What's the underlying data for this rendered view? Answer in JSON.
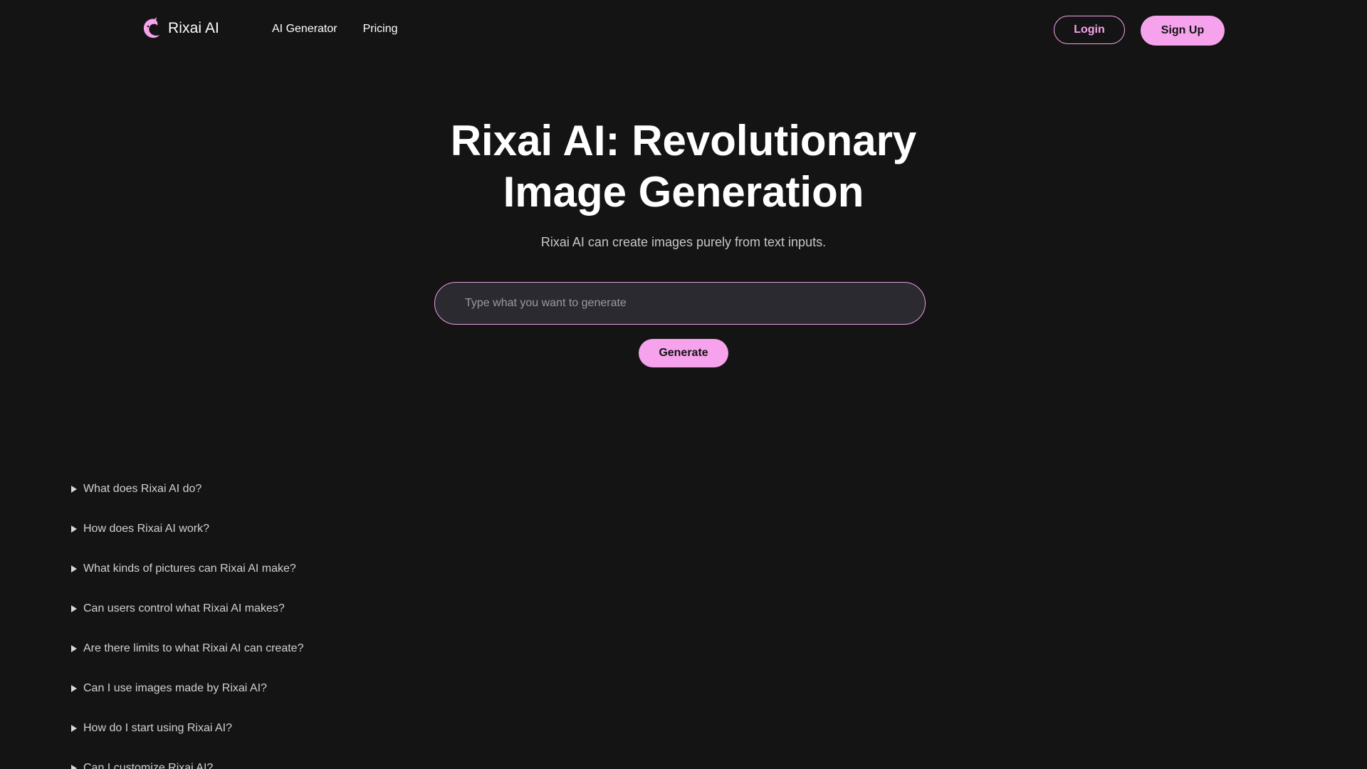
{
  "header": {
    "brand": "Rixai AI",
    "logo_icon": "dolphin-logo-icon",
    "nav": [
      {
        "label": "AI Generator"
      },
      {
        "label": "Pricing"
      }
    ],
    "login_label": "Login",
    "signup_label": "Sign Up"
  },
  "hero": {
    "title_line1": "Rixai AI: Revolutionary",
    "title_line2": "Image Generation",
    "subtitle": "Rixai AI can create images purely from text inputs.",
    "prompt_placeholder": "Type what you want to generate",
    "prompt_value": "",
    "generate_label": "Generate"
  },
  "faq": [
    {
      "question": "What does Rixai AI do?"
    },
    {
      "question": "How does Rixai AI work?"
    },
    {
      "question": "What kinds of pictures can Rixai AI make?"
    },
    {
      "question": "Can users control what Rixai AI makes?"
    },
    {
      "question": "Are there limits to what Rixai AI can create?"
    },
    {
      "question": "Can I use images made by Rixai AI?"
    },
    {
      "question": "How do I start using Rixai AI?"
    },
    {
      "question": "Can I customize Rixai AI?"
    }
  ],
  "colors": {
    "background": "#141414",
    "accent": "#f6a2ec",
    "input_background": "#2a2a30"
  }
}
